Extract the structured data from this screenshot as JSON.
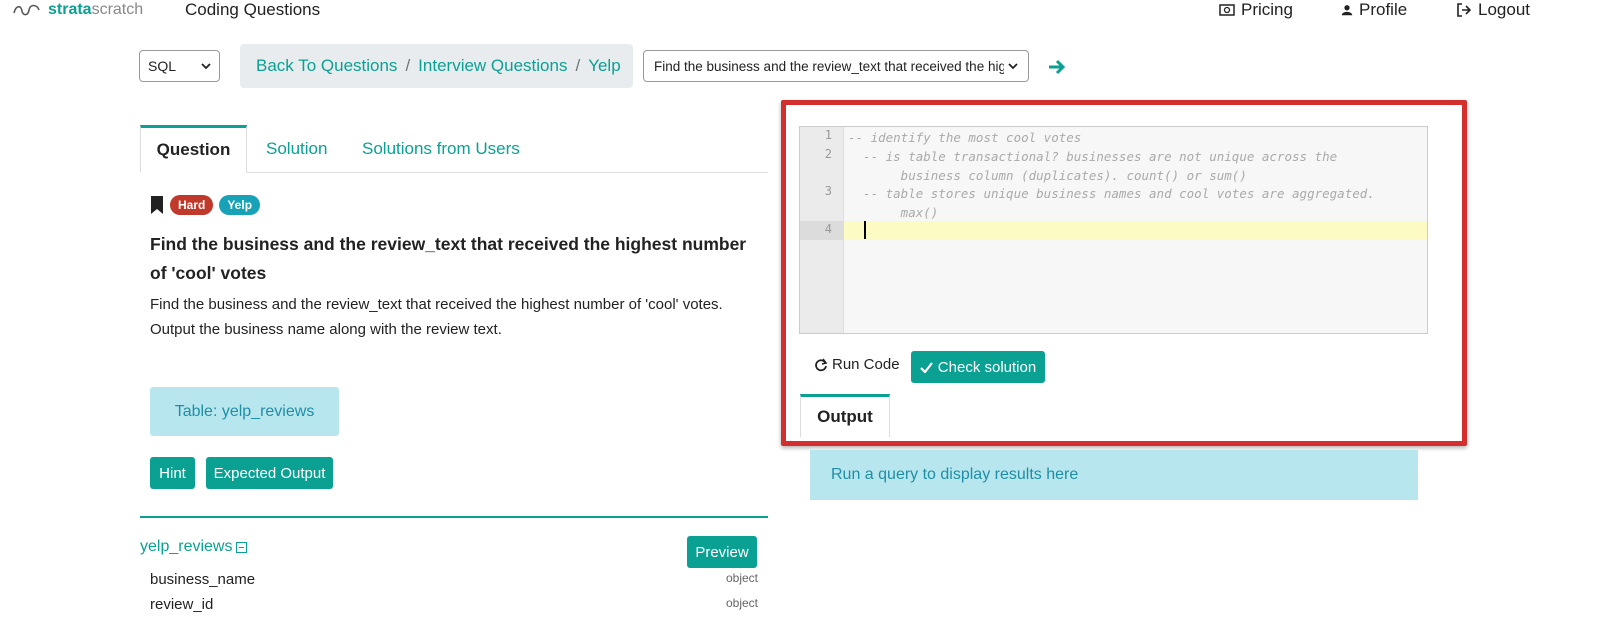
{
  "nav": {
    "logo_bold": "strata",
    "logo_light": "scratch",
    "coding_questions": "Coding Questions",
    "pricing": "Pricing",
    "profile": "Profile",
    "logout": "Logout"
  },
  "toolbar": {
    "language": "SQL",
    "breadcrumb": [
      "Back To Questions",
      "Interview Questions",
      "Yelp"
    ],
    "breadcrumb_sep": "/",
    "question_select": "Find the business and the review_text that received the highest number of 'cool' votes"
  },
  "tabs": [
    "Question",
    "Solution",
    "Solutions from Users"
  ],
  "question": {
    "badges": [
      "Hard",
      "Yelp"
    ],
    "title": "Find the business and the review_text that received the highest number of 'cool' votes",
    "desc_line1": "Find the business and the review_text that received the highest number of  'cool' votes.",
    "desc_line2": "Output the business name along with the review text.",
    "table_label": "Table: yelp_reviews",
    "hint": "Hint",
    "expected_output": "Expected Output"
  },
  "schema": {
    "table_name": "yelp_reviews",
    "preview": "Preview",
    "columns": [
      {
        "name": "business_name",
        "type": "object"
      },
      {
        "name": "review_id",
        "type": "object"
      }
    ]
  },
  "editor": {
    "lines": [
      {
        "num": "1",
        "text": "-- identify the most cool votes"
      },
      {
        "num": "2",
        "text": "  -- is table transactional? businesses are not unique across the\n       business column (duplicates). count() or sum()"
      },
      {
        "num": "3",
        "text": "  -- table stores unique business names and cool votes are aggregated.\n       max()"
      },
      {
        "num": "4",
        "text": ""
      }
    ],
    "run_code": "Run Code",
    "check_solution": "Check solution",
    "output_tab": "Output",
    "output_placeholder": "Run a query to display results here"
  },
  "colors": {
    "accent": "#0aa192",
    "highlight_frame": "#d32f2f",
    "hard_badge": "#c0392b",
    "yelp_badge": "#17a2b8"
  }
}
